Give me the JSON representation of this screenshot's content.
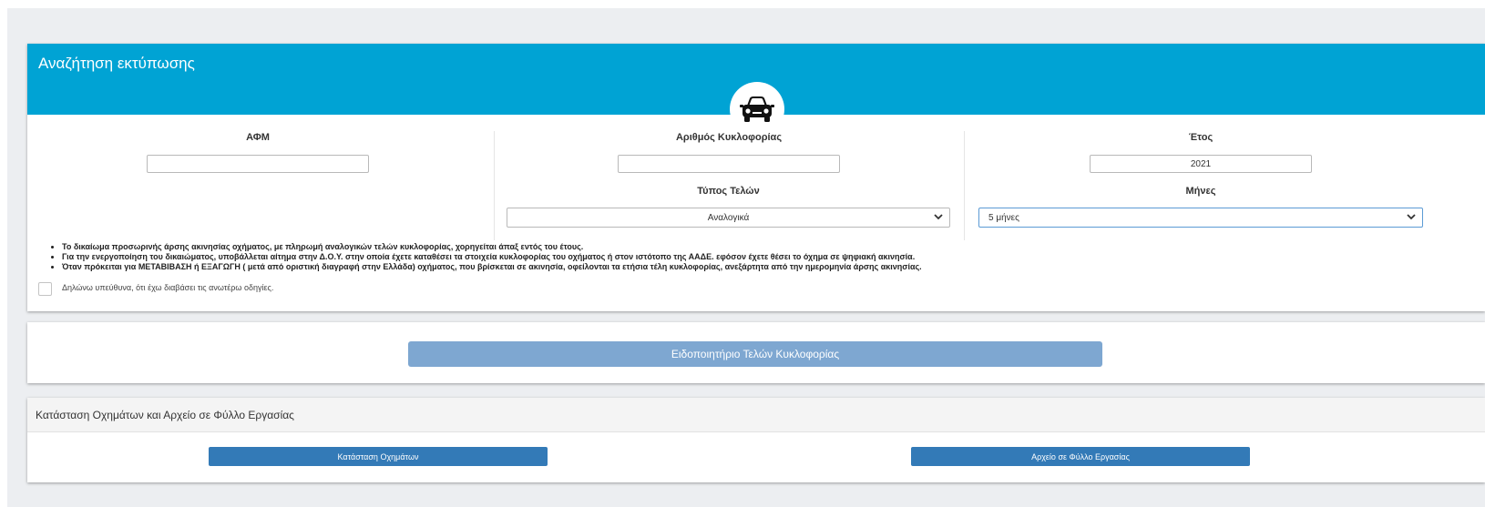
{
  "search": {
    "title": "Αναζήτηση εκτύπωσης",
    "icon": "car-icon",
    "afm_label": "ΑΦΜ",
    "afm_value": "",
    "plate_label": "Αριθμός Κυκλοφορίας",
    "plate_value": "",
    "year_label": "Έτος",
    "year_value": "2021",
    "fee_type_label": "Τύπος Τελών",
    "fee_type_value": "Αναλογικά",
    "months_label": "Μήνες",
    "months_value": "5 μήνες",
    "notes": [
      "Το δικαίωμα προσωρινής άρσης ακινησίας οχήματος, με πληρωμή αναλογικών τελών κυκλοφορίας, χορηγείται άπαξ εντός του έτους.",
      "Για την ενεργοποίηση του δικαιώματος, υποβάλλεται αίτημα στην Δ.Ο.Υ. στην οποία έχετε καταθέσει τα στοιχεία κυκλοφορίας του οχήματος ή στον ιστότοπο της ΑΑΔΕ. εφόσον έχετε θέσει το όχημα σε ψηφιακή ακινησία.",
      "Όταν πρόκειται για ΜΕΤΑΒΙΒΑΣΗ ή ΕΞΑΓΩΓΗ ( μετά από οριστική διαγραφή στην Ελλάδα) οχήματος, που βρίσκεται σε ακινησία, οφείλονται τα ετήσια τέλη κυκλοφορίας, ανεξάρτητα από την ημερομηνία άρσης ακινησίας."
    ],
    "declaration_checked": false,
    "declaration_label": "Δηλώνω υπεύθυνα, ότι έχω διαβάσει τις ανωτέρω οδηγίες."
  },
  "notice": {
    "button_label": "Ειδοποιητήριο Τελών Κυκλοφορίας"
  },
  "status": {
    "title": "Κατάσταση Οχημάτων και Αρχείο σε Φύλλο Εργασίας",
    "vehicles_button": "Κατάσταση Οχημάτων",
    "spreadsheet_button": "Αρχείο σε Φύλλο Εργασίας"
  },
  "colors": {
    "banner": "#00a3d4",
    "primary_button": "#337ab7",
    "disabled_button": "#7ea7d1"
  }
}
